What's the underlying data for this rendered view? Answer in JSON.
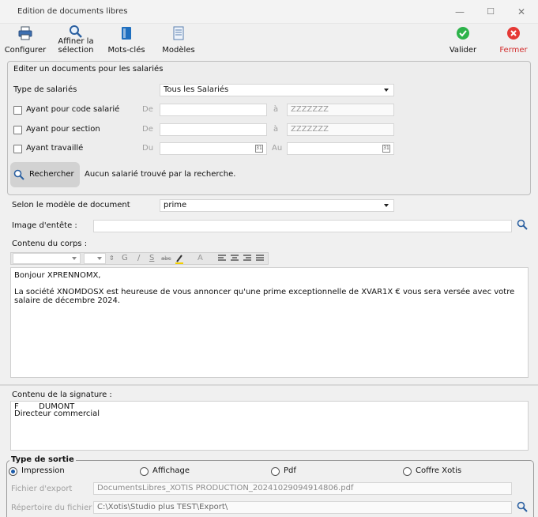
{
  "window": {
    "title": "Edition de documents libres",
    "minimize": "—",
    "maximize": "☐",
    "close": "✕"
  },
  "toolbar": {
    "configurer": "Configurer",
    "affiner_1": "Affiner la",
    "affiner_2": "sélection",
    "mots_cles": "Mots-clés",
    "modeles": "Modèles",
    "valider": "Valider",
    "fermer": "Fermer",
    "colors": {
      "valider": "#2db34a",
      "fermer": "#e53935",
      "fermer_text": "#d32f2f",
      "accent": "#1f6fbf"
    }
  },
  "filters": {
    "heading": "Editer un documents pour les salariés",
    "type_label": "Type de salariés",
    "type_value": "Tous les Salariés",
    "code_label": "Ayant pour code salarié",
    "code_de": "De",
    "code_a": "à",
    "code_to_value": "ZZZZZZZ",
    "section_label": "Ayant pour section",
    "section_de": "De",
    "section_a": "à",
    "section_to_value": "ZZZZZZZ",
    "travail_label": "Ayant travaillé",
    "travail_du": "Du",
    "travail_au": "Au",
    "cal_glyph": "31",
    "search_button": "Rechercher",
    "search_result": "Aucun salarié trouvé par la recherche."
  },
  "document": {
    "modele_label": "Selon le modèle de document",
    "modele_value": "prime",
    "image_label": "Image d'entête :",
    "corps_label": "Contenu du corps :",
    "editor_toolbar": {
      "bold": "G",
      "italic": "/",
      "underline": "S",
      "strike": "abc",
      "font": "A"
    },
    "body_line1": "Bonjour XPRENNOMX,",
    "body_line2": "La société XNOMDOSX est heureuse de vous annoncer qu'une prime exceptionnelle de XVAR1X € vous sera versée avec votre",
    "body_line3": "salaire de décembre 2024."
  },
  "signature": {
    "label": "Contenu de la signature :",
    "line1": "F        DUMONT",
    "line2": "Directeur commercial"
  },
  "output": {
    "legend": "Type de sortie",
    "options": [
      "Impression",
      "Affichage",
      "Pdf",
      "Coffre Xotis"
    ],
    "selected": "Impression",
    "export_label": "Fichier d'export",
    "export_value": "DocumentsLibres_XOTIS PRODUCTION_20241029094914806.pdf",
    "dir_label": "Répertoire du fichier",
    "dir_value": "C:\\Xotis\\Studio plus TEST\\Export\\"
  }
}
